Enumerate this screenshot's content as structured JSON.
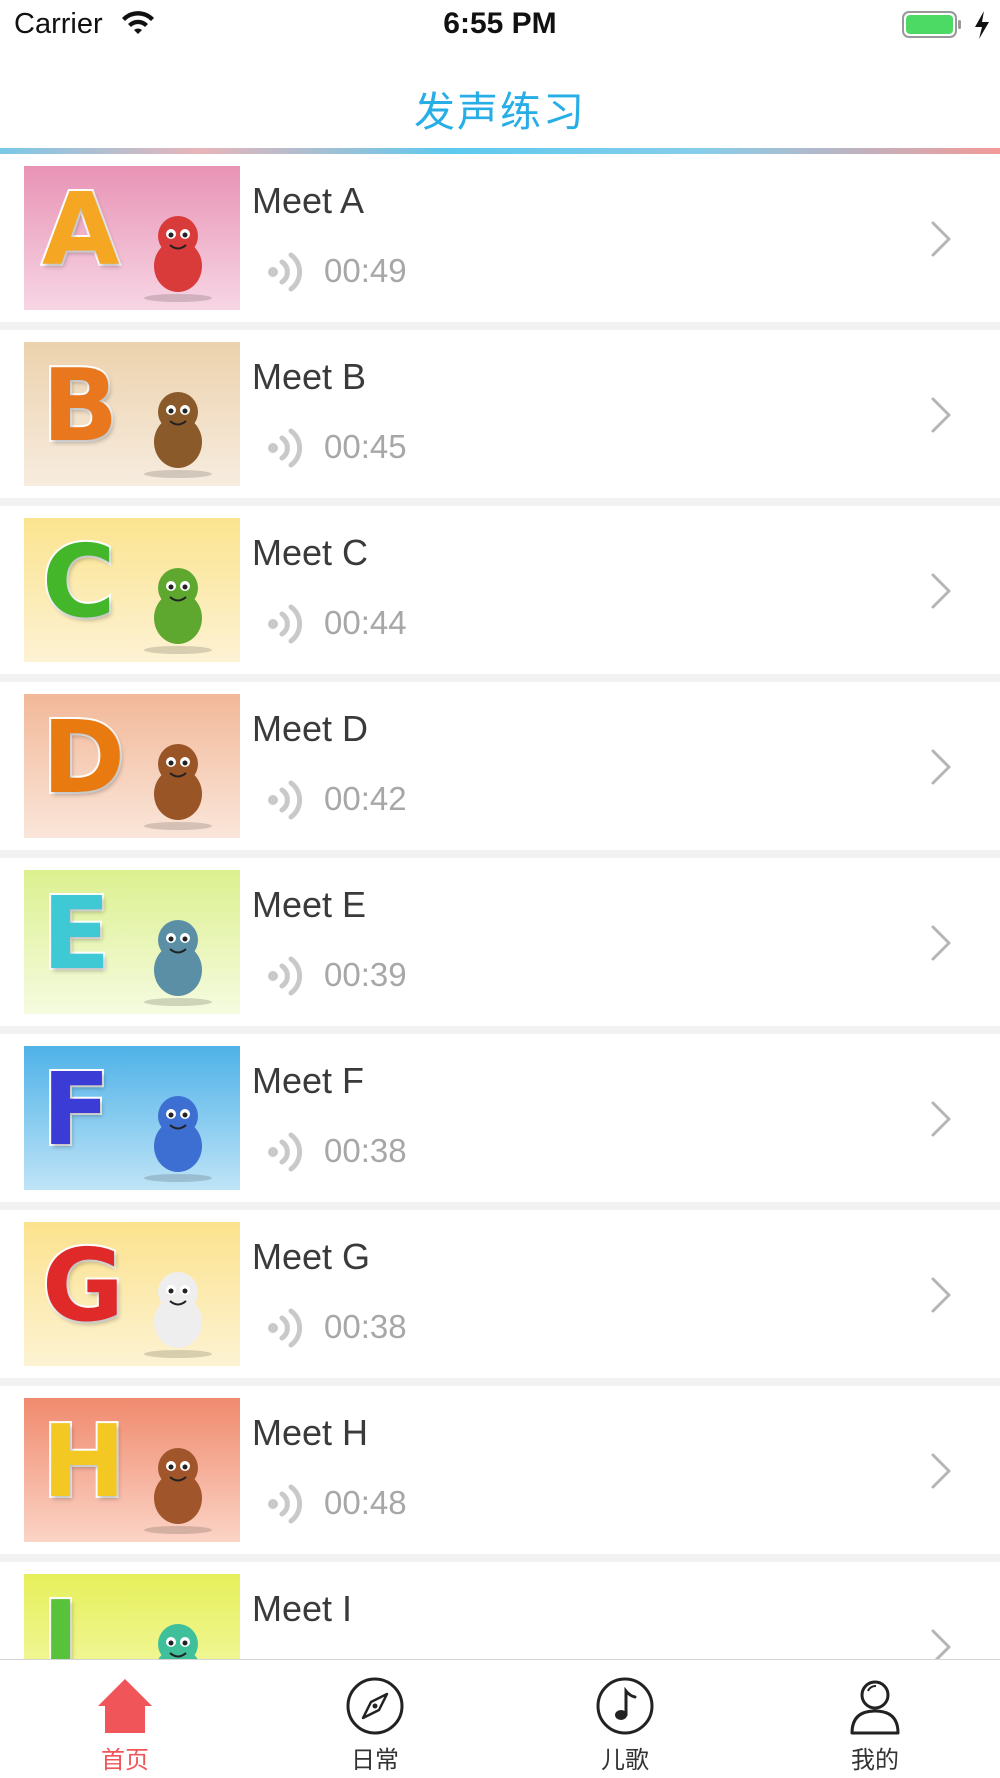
{
  "status_bar": {
    "carrier": "Carrier",
    "time": "6:55 PM"
  },
  "nav_bar": {
    "title": "发声练习"
  },
  "lessons": [
    {
      "title": "Meet A",
      "duration": "00:49",
      "letter": "A",
      "letter_color": "#f5a623",
      "bg_top": "#e893b5",
      "bg_bottom": "#f7d6e4",
      "char_color": "#d93a3a"
    },
    {
      "title": "Meet B",
      "duration": "00:45",
      "letter": "B",
      "letter_color": "#e8771e",
      "bg_top": "#ecd2ad",
      "bg_bottom": "#f7ecdf",
      "char_color": "#8b5a2b"
    },
    {
      "title": "Meet C",
      "duration": "00:44",
      "letter": "C",
      "letter_color": "#43b62a",
      "bg_top": "#fbe48f",
      "bg_bottom": "#fdf2d4",
      "char_color": "#5fa830"
    },
    {
      "title": "Meet D",
      "duration": "00:42",
      "letter": "D",
      "letter_color": "#e87a10",
      "bg_top": "#f2b898",
      "bg_bottom": "#fae6da",
      "char_color": "#9a5527"
    },
    {
      "title": "Meet E",
      "duration": "00:39",
      "letter": "E",
      "letter_color": "#3fc9d4",
      "bg_top": "#dcf08f",
      "bg_bottom": "#f5fbe0",
      "char_color": "#5a8fa5"
    },
    {
      "title": "Meet F",
      "duration": "00:38",
      "letter": "F",
      "letter_color": "#3b3bd6",
      "bg_top": "#4fb2e8",
      "bg_bottom": "#bfe4f7",
      "char_color": "#3c6fd1"
    },
    {
      "title": "Meet G",
      "duration": "00:38",
      "letter": "G",
      "letter_color": "#e02a2a",
      "bg_top": "#fbe28d",
      "bg_bottom": "#fdf3d3",
      "char_color": "#eeeeee"
    },
    {
      "title": "Meet H",
      "duration": "00:48",
      "letter": "H",
      "letter_color": "#f3c823",
      "bg_top": "#f08a6e",
      "bg_bottom": "#fbd4c6",
      "char_color": "#a0562a"
    },
    {
      "title": "Meet I",
      "duration": "",
      "letter": "I",
      "letter_color": "#57c23a",
      "bg_top": "#e6f05a",
      "bg_bottom": "#f6fab8",
      "char_color": "#3fbf9a"
    }
  ],
  "tabs": [
    {
      "label": "首页",
      "icon": "home-icon",
      "active": true
    },
    {
      "label": "日常",
      "icon": "compass-icon",
      "active": false
    },
    {
      "label": "儿歌",
      "icon": "music-note-icon",
      "active": false
    },
    {
      "label": "我的",
      "icon": "user-icon",
      "active": false
    }
  ],
  "colors": {
    "accent": "#27aee6",
    "tab_active": "#f0555a",
    "battery": "#4cd964"
  }
}
